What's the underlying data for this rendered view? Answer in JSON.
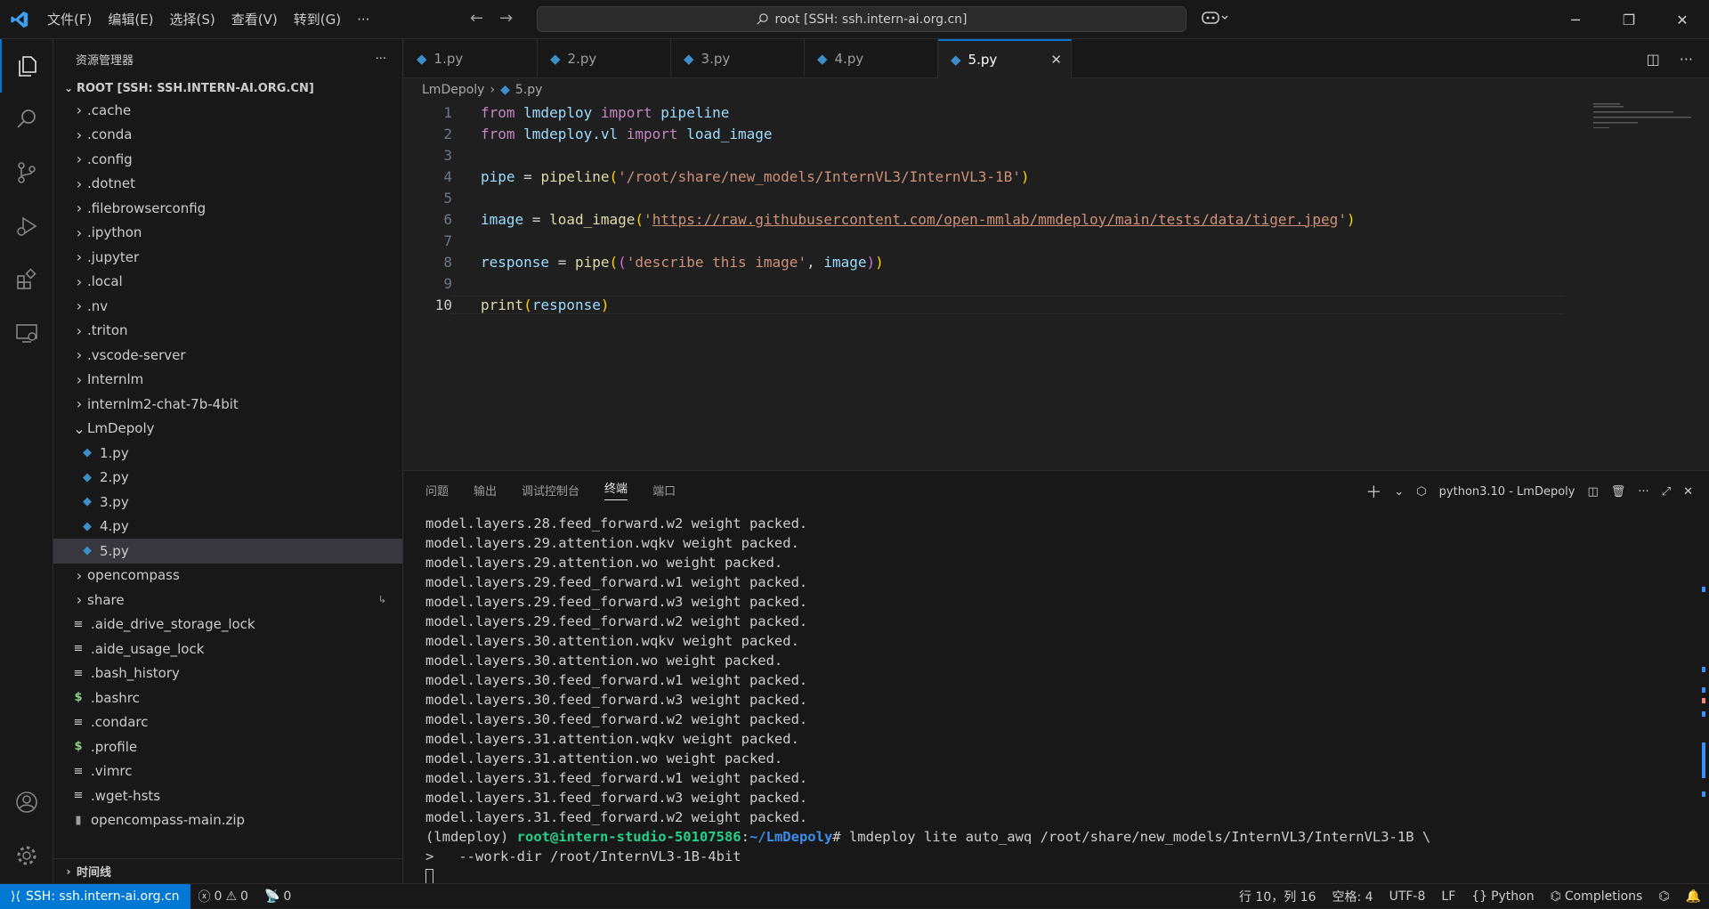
{
  "titlebar": {
    "menu": [
      "文件(F)",
      "编辑(E)",
      "选择(S)",
      "查看(V)",
      "转到(G)",
      "···"
    ],
    "search_text": "root [SSH: ssh.intern-ai.org.cn]"
  },
  "sidebar": {
    "title": "资源管理器",
    "root": "ROOT [SSH: SSH.INTERN-AI.ORG.CN]",
    "items": [
      {
        "label": ".cache",
        "kind": "folder"
      },
      {
        "label": ".conda",
        "kind": "folder"
      },
      {
        "label": ".config",
        "kind": "folder"
      },
      {
        "label": ".dotnet",
        "kind": "folder"
      },
      {
        "label": ".filebrowserconfig",
        "kind": "folder"
      },
      {
        "label": ".ipython",
        "kind": "folder"
      },
      {
        "label": ".jupyter",
        "kind": "folder"
      },
      {
        "label": ".local",
        "kind": "folder"
      },
      {
        "label": ".nv",
        "kind": "folder"
      },
      {
        "label": ".triton",
        "kind": "folder"
      },
      {
        "label": ".vscode-server",
        "kind": "folder"
      },
      {
        "label": "Internlm",
        "kind": "folder"
      },
      {
        "label": "internlm2-chat-7b-4bit",
        "kind": "folder"
      },
      {
        "label": "LmDepoly",
        "kind": "folder-open"
      },
      {
        "label": "1.py",
        "kind": "py"
      },
      {
        "label": "2.py",
        "kind": "py"
      },
      {
        "label": "3.py",
        "kind": "py"
      },
      {
        "label": "4.py",
        "kind": "py"
      },
      {
        "label": "5.py",
        "kind": "py"
      },
      {
        "label": "opencompass",
        "kind": "folder"
      },
      {
        "label": "share",
        "kind": "folder"
      },
      {
        "label": ".aide_drive_storage_lock",
        "kind": "txt"
      },
      {
        "label": ".aide_usage_lock",
        "kind": "txt"
      },
      {
        "label": ".bash_history",
        "kind": "txt"
      },
      {
        "label": ".bashrc",
        "kind": "sh"
      },
      {
        "label": ".condarc",
        "kind": "txt"
      },
      {
        "label": ".profile",
        "kind": "sh"
      },
      {
        "label": ".vimrc",
        "kind": "txt"
      },
      {
        "label": ".wget-hsts",
        "kind": "txt"
      },
      {
        "label": "opencompass-main.zip",
        "kind": "zip"
      }
    ],
    "timeline": "时间线"
  },
  "editor": {
    "tabs": [
      "1.py",
      "2.py",
      "3.py",
      "4.py",
      "5.py"
    ],
    "breadcrumb": [
      "LmDepoly",
      "5.py"
    ],
    "line_numbers": [
      "1",
      "2",
      "3",
      "4",
      "5",
      "6",
      "7",
      "8",
      "9",
      "10"
    ],
    "code": {
      "l1": {
        "kw1": "from",
        "mod": " lmdeploy ",
        "kw2": "import",
        "name": " pipeline"
      },
      "l2": {
        "kw1": "from",
        "mod": " lmdeploy.vl ",
        "kw2": "import",
        "name": " load_image"
      },
      "l4": {
        "var": "pipe",
        "eq": " = ",
        "fn": "pipeline",
        "p1": "(",
        "str": "'/root/share/new_models/InternVL3/InternVL3-1B'",
        "p2": ")"
      },
      "l6": {
        "var": "image",
        "eq": " = ",
        "fn": "load_image",
        "p1": "(",
        "q1": "'",
        "url": "https://raw.githubusercontent.com/open-mmlab/mmdeploy/main/tests/data/tiger.jpeg",
        "q2": "'",
        "p2": ")"
      },
      "l8": {
        "var": "response",
        "eq": " = ",
        "fn": "pipe",
        "p1": "(",
        "p3": "(",
        "str": "'describe this image'",
        "mid": ", ",
        "var2": "image",
        "p4": ")",
        "p2": ")"
      },
      "l10": {
        "fn": "print",
        "p1": "(",
        "var": "response",
        "p2": ")"
      }
    }
  },
  "panel": {
    "tabs": [
      "问题",
      "输出",
      "调试控制台",
      "终端",
      "端口"
    ],
    "active_tab": "终端",
    "terminal_name": "python3.10 - LmDepoly",
    "lines": [
      "model.layers.28.feed_forward.w2 weight packed.",
      "model.layers.29.attention.wqkv weight packed.",
      "model.layers.29.attention.wo weight packed.",
      "model.layers.29.feed_forward.w1 weight packed.",
      "model.layers.29.feed_forward.w3 weight packed.",
      "model.layers.29.feed_forward.w2 weight packed.",
      "model.layers.30.attention.wqkv weight packed.",
      "model.layers.30.attention.wo weight packed.",
      "model.layers.30.feed_forward.w1 weight packed.",
      "model.layers.30.feed_forward.w3 weight packed.",
      "model.layers.30.feed_forward.w2 weight packed.",
      "model.layers.31.attention.wqkv weight packed.",
      "model.layers.31.attention.wo weight packed.",
      "model.layers.31.feed_forward.w1 weight packed.",
      "model.layers.31.feed_forward.w3 weight packed.",
      "model.layers.31.feed_forward.w2 weight packed."
    ],
    "prompt_env": "(lmdeploy) ",
    "prompt_user": "root@intern-studio-50107586",
    "prompt_sep": ":",
    "prompt_path": "~/LmDepoly",
    "prompt_cmd": "# lmdeploy lite auto_awq /root/share/new_models/InternVL3/InternVL3-1B \\",
    "continuation": ">   --work-dir /root/InternVL3-1B-4bit"
  },
  "statusbar": {
    "remote": "SSH: ssh.intern-ai.org.cn",
    "errors": "0",
    "warnings": "0",
    "ports": "0",
    "position": "行 10，列 16",
    "spaces": "空格: 4",
    "encoding": "UTF-8",
    "eol": "LF",
    "language": "Python",
    "completions": "Completions"
  },
  "colors": {
    "accent": "#0078d4",
    "background": "#1f1f1f",
    "sidebar": "#181818"
  }
}
